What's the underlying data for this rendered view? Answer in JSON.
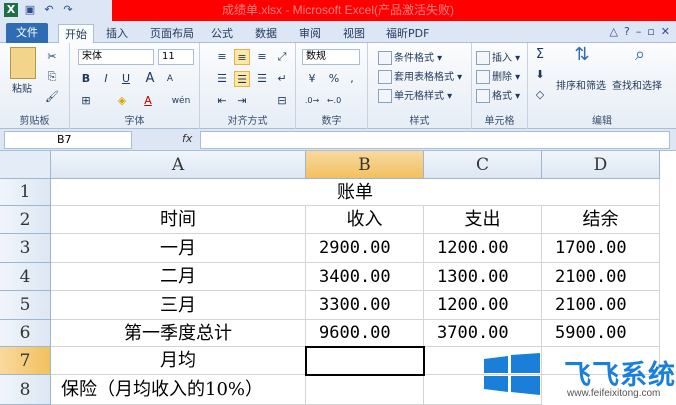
{
  "window": {
    "title": "成绩单.xlsx - Microsoft Excel(产品激活失败)",
    "qat_icons": [
      "excel-icon",
      "save-icon",
      "undo-icon",
      "redo-icon"
    ]
  },
  "tabs": {
    "file": "文件",
    "items": [
      "开始",
      "插入",
      "页面布局",
      "公式",
      "数据",
      "审阅",
      "视图",
      "福昕PDF"
    ],
    "active": "开始"
  },
  "ribbon": {
    "clipboard": {
      "paste": "粘贴",
      "label": "剪贴板"
    },
    "font": {
      "name": "宋体",
      "size": "11",
      "label": "字体",
      "size_up": "A",
      "size_down": "A",
      "bold": "B",
      "italic": "I",
      "underline": "U",
      "font_color": "A",
      "phonetic": "wén"
    },
    "alignment": {
      "label": "对齐方式"
    },
    "number": {
      "format": "数规",
      "label": "数字",
      "percent": "%",
      "comma": ","
    },
    "styles": {
      "conditional": "条件格式",
      "table": "套用表格格式",
      "cell": "单元格样式",
      "label": "样式"
    },
    "cells": {
      "insert": "插入",
      "delete": "删除",
      "format": "格式",
      "label": "单元格"
    },
    "editing": {
      "sum": "Σ",
      "sort": "排序和筛选",
      "find": "查找和选择",
      "label": "编辑"
    }
  },
  "formula_bar": {
    "name_box": "B7",
    "fx": "fx",
    "value": ""
  },
  "sheet": {
    "columns": [
      "A",
      "B",
      "C",
      "D"
    ],
    "selected_column": "B",
    "rows": [
      "1",
      "2",
      "3",
      "4",
      "5",
      "6",
      "7",
      "8"
    ],
    "selected_row": "7",
    "active_cell": "B7",
    "cells": {
      "r1": {
        "title": "账单"
      },
      "r2": {
        "a": "时间",
        "b": "收入",
        "c": "支出",
        "d": "结余"
      },
      "r3": {
        "a": "一月",
        "b": "2900.00",
        "c": "1200.00",
        "d": "1700.00"
      },
      "r4": {
        "a": "二月",
        "b": "3400.00",
        "c": "1300.00",
        "d": "2100.00"
      },
      "r5": {
        "a": "三月",
        "b": "3300.00",
        "c": "1200.00",
        "d": "2100.00"
      },
      "r6": {
        "a": "第一季度总计",
        "b": "9600.00",
        "c": "3700.00",
        "d": "5900.00"
      },
      "r7": {
        "a": "月均",
        "b": "",
        "c": "",
        "d": ""
      },
      "r8": {
        "a": "保险（月均收入的10%）"
      }
    }
  },
  "watermark": {
    "title": "飞飞系统",
    "url": "www.feifeixitong.com"
  },
  "colors": {
    "accent": "#2e6db4",
    "title_bar_overlay": "#ff0000",
    "selected_header": "#f1c15f",
    "watermark_blue": "#1a7fd8"
  }
}
